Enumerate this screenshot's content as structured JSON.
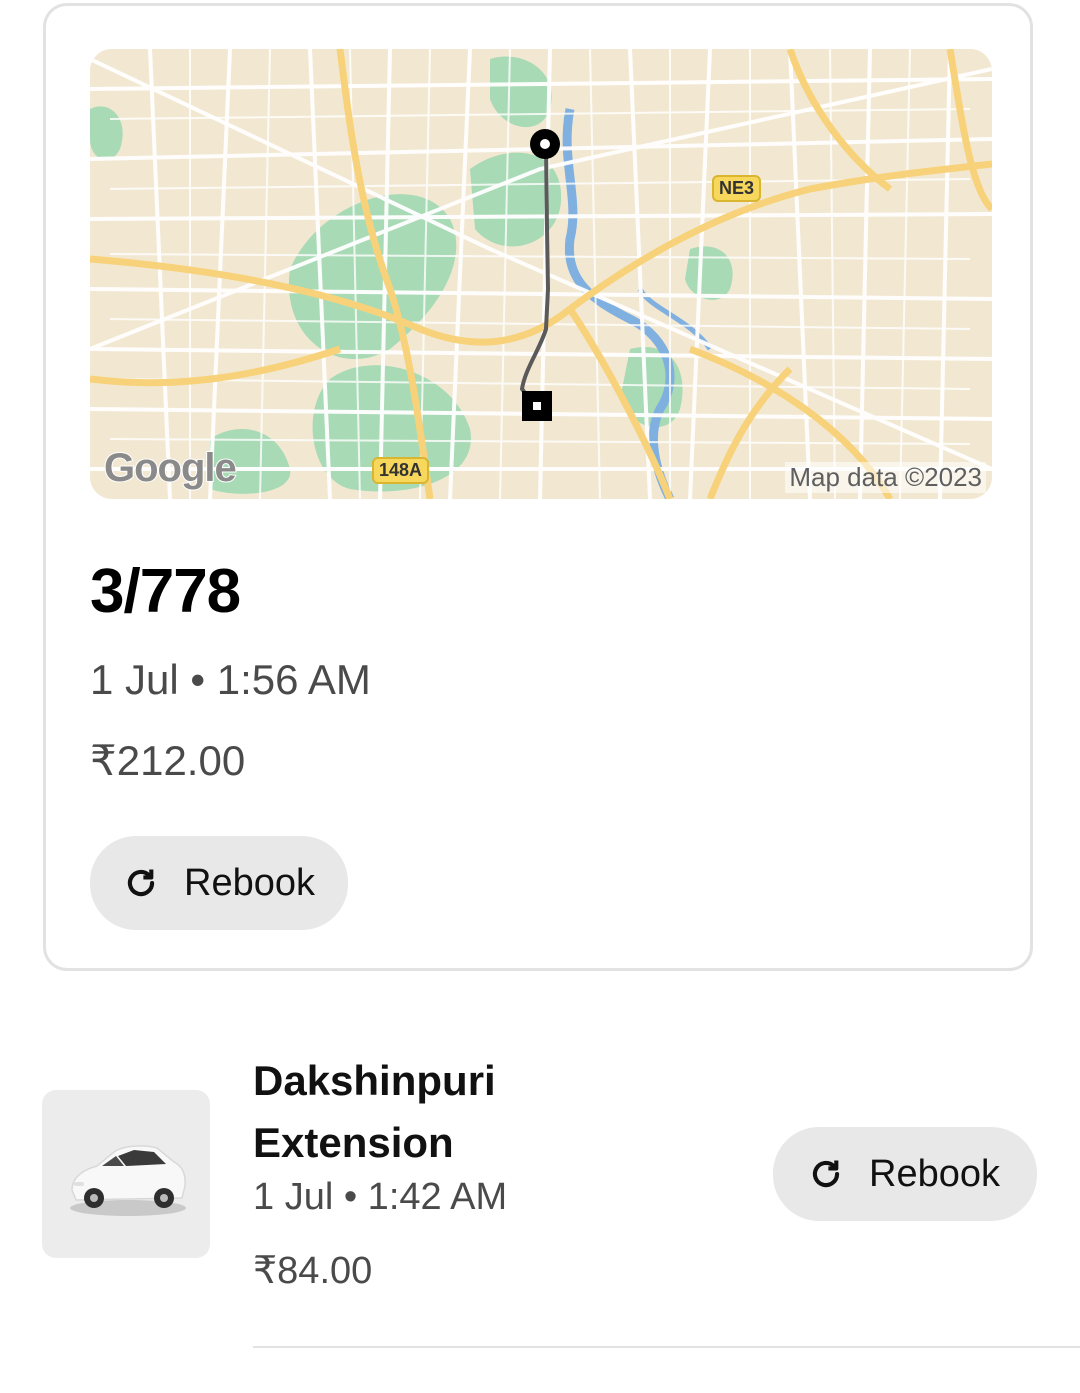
{
  "trip_card": {
    "map": {
      "attribution": "Google",
      "credit": "Map data ©2023",
      "road_labels": [
        "NE3",
        "148A"
      ],
      "route_color": "#000000"
    },
    "title": "3/778",
    "datetime": "1 Jul • 1:56 AM",
    "price": "₹212.00",
    "rebook_label": "Rebook"
  },
  "trips": [
    {
      "title": "Dakshinpuri Extension",
      "datetime": "1 Jul • 1:42 AM",
      "price": "₹84.00",
      "rebook_label": "Rebook",
      "thumbnail_icon": "car-icon"
    }
  ],
  "colors": {
    "button_bg": "#e8e8e8",
    "card_border": "#e2e2e2",
    "map_land": "#f2e8d2",
    "map_park": "#a8dab5",
    "map_water": "#7fb0e0",
    "map_highway": "#f7d27a"
  },
  "icons": {
    "rebook": "refresh-icon",
    "pickup": "pickup-pin-icon",
    "dropoff": "dropoff-pin-icon"
  }
}
